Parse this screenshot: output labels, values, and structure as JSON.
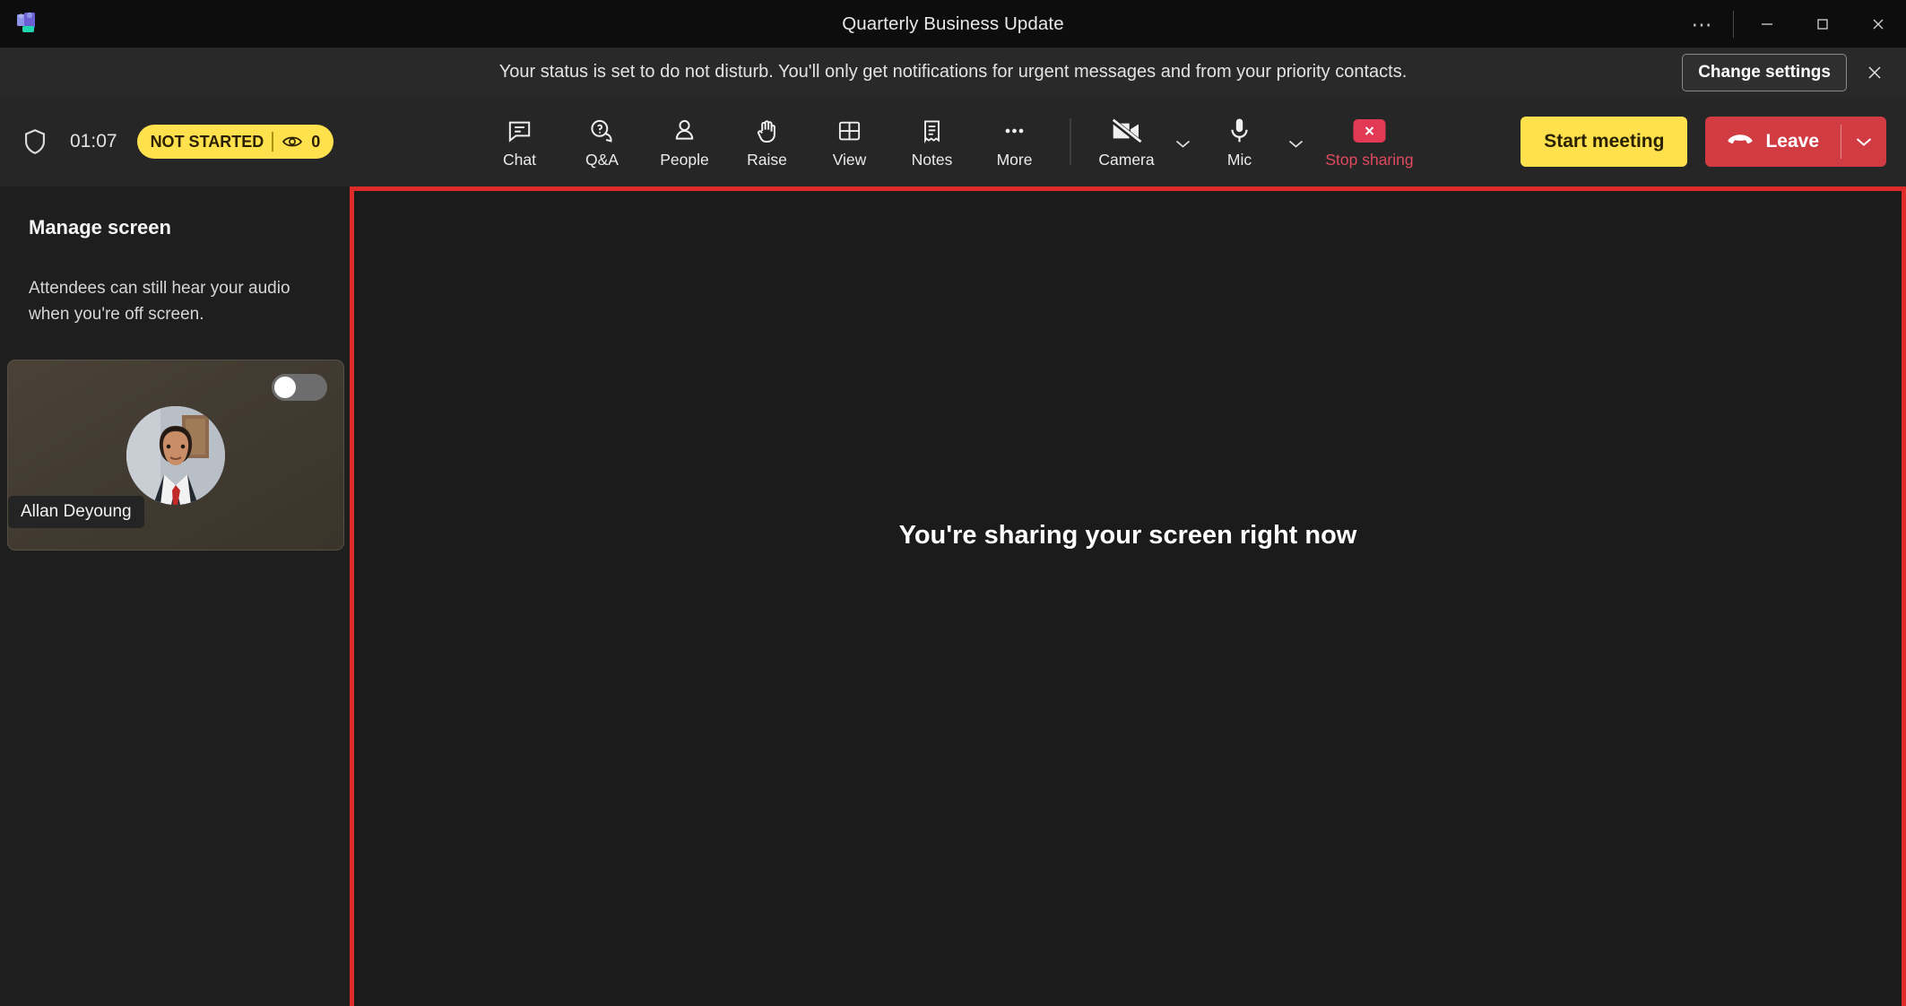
{
  "window": {
    "title": "Quarterly Business Update",
    "logo_icon": "teams-app-icon",
    "more_options_icon": "ellipsis-icon",
    "minimize_icon": "minimize-icon",
    "maximize_icon": "maximize-icon",
    "close_icon": "close-icon"
  },
  "banner": {
    "message": "Your status is set to do not disturb. You'll only get notifications for urgent messages and from your priority contacts.",
    "action_label": "Change settings",
    "close_icon": "close-icon"
  },
  "toolbar": {
    "shield_icon": "shield-icon",
    "timer": "01:07",
    "status_label": "NOT STARTED",
    "viewer_icon": "eye-icon",
    "viewer_count": "0",
    "items": [
      {
        "label": "Chat",
        "icon": "chat-icon"
      },
      {
        "label": "Q&A",
        "icon": "question-answer-icon"
      },
      {
        "label": "People",
        "icon": "people-icon"
      },
      {
        "label": "Raise",
        "icon": "raise-hand-icon"
      },
      {
        "label": "View",
        "icon": "view-grid-icon"
      },
      {
        "label": "Notes",
        "icon": "notes-icon"
      },
      {
        "label": "More",
        "icon": "more-ellipsis-icon"
      }
    ],
    "camera": {
      "label": "Camera",
      "icon": "camera-off-icon",
      "chevron_icon": "chevron-down-icon"
    },
    "mic": {
      "label": "Mic",
      "icon": "microphone-icon",
      "chevron_icon": "chevron-down-icon"
    },
    "stop_sharing": {
      "label": "Stop sharing",
      "icon": "stop-sharing-icon"
    },
    "start_meeting_label": "Start meeting",
    "leave": {
      "label": "Leave",
      "icon": "hangup-phone-icon",
      "chevron_icon": "chevron-down-icon"
    }
  },
  "sidebar": {
    "title": "Manage screen",
    "description": "Attendees can still hear your audio when you're off screen.",
    "participant": {
      "name": "Allan Deyoung",
      "toggle_state": "off"
    }
  },
  "main": {
    "sharing_message": "You're sharing your screen right now"
  },
  "colors": {
    "accent_yellow": "#ffe14d",
    "leave_red": "#d13c43",
    "share_border_red": "#e02b2b",
    "stop_sharing_red": "#e23a54",
    "window_bg": "#1c1c1c",
    "toolbar_bg": "#262626"
  }
}
